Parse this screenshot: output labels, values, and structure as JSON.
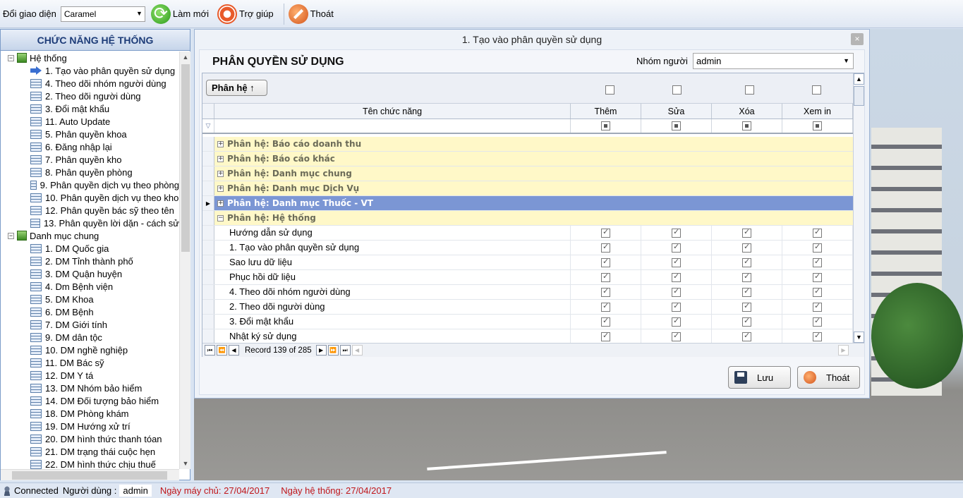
{
  "toolbar": {
    "theme_label": "Đổi giao diện",
    "theme_value": "Caramel",
    "refresh_label": "Làm mới",
    "help_label": "Trợ giúp",
    "exit_label": "Thoát"
  },
  "sidebar": {
    "title": "CHỨC NĂNG HỆ THỐNG",
    "groups": [
      {
        "label": "Hệ thống",
        "items": [
          "1. Tạo vào phân quyền sử dụng",
          "4. Theo dõi nhóm người dùng",
          "2. Theo dõi người dùng",
          "3. Đổi mật khẩu",
          "11. Auto Update",
          "5. Phân quyền khoa",
          "6. Đăng nhập lại",
          "7. Phân quyền kho",
          "8. Phân quyền phòng",
          "9. Phân quyền dịch vụ theo phòng",
          "10. Phân quyền dịch vụ theo kho",
          "12. Phân quyền bác sỹ theo tên",
          "13. Phân quyền lời dặn - cách sử"
        ]
      },
      {
        "label": "Danh mục chung",
        "items": [
          "1. DM Quốc gia",
          "2. DM Tỉnh thành phố",
          "3. DM Quận huyện",
          "4. Dm Bệnh viện",
          "5. DM Khoa",
          "6. DM Bệnh",
          "7. DM Giới tính",
          "9. DM dân tộc",
          "10. DM nghề nghiệp",
          "11. DM Bác sỹ",
          "12. DM Y tá",
          "13. DM Nhóm bảo hiểm",
          "14. DM Đối tượng bảo hiểm",
          "18. DM Phòng khám",
          "19. DM Hướng xử trí",
          "20. DM hình thức thanh tóan",
          "21. DM trạng thái cuộc hẹn",
          "22. DM hình thức chịu thuế"
        ]
      }
    ]
  },
  "dialog": {
    "title": "1. Tạo vào phân quyền sử dụng",
    "close": "×",
    "heading": "PHÂN QUYỀN SỬ DỤNG",
    "group_label": "Nhóm người",
    "group_value": "admin",
    "group_by_label": "Phân hệ ↑",
    "columns": [
      "Tên chức năng",
      "Thêm",
      "Sửa",
      "Xóa",
      "Xem in"
    ],
    "groups": [
      "Phân hệ: Báo cáo doanh thu",
      "Phân hệ: Báo cáo khác",
      "Phân hệ: Danh mục chung",
      "Phân hệ: Danh mục Dịch Vụ",
      "Phân hệ: Danh mục Thuốc - VT",
      "Phân hệ: Hệ thống"
    ],
    "rows": [
      "Hướng dẫn sử dụng",
      "1. Tạo vào phân quyền sử dụng",
      "Sao lưu dữ liệu",
      "Phục hồi dữ liệu",
      "4. Theo dõi nhóm người dùng",
      "2. Theo dõi người dùng",
      "3. Đổi mật khẩu",
      "Nhật ký sử dụng"
    ],
    "record_text": "Record 139 of 285",
    "save_label": "Lưu",
    "exit_label": "Thoát"
  },
  "status": {
    "connected": "Connected",
    "user_label": "Người dùng :",
    "user_value": "admin",
    "server_date": "Ngày máy chủ: 27/04/2017",
    "system_date": "Ngày hệ thống: 27/04/2017"
  }
}
